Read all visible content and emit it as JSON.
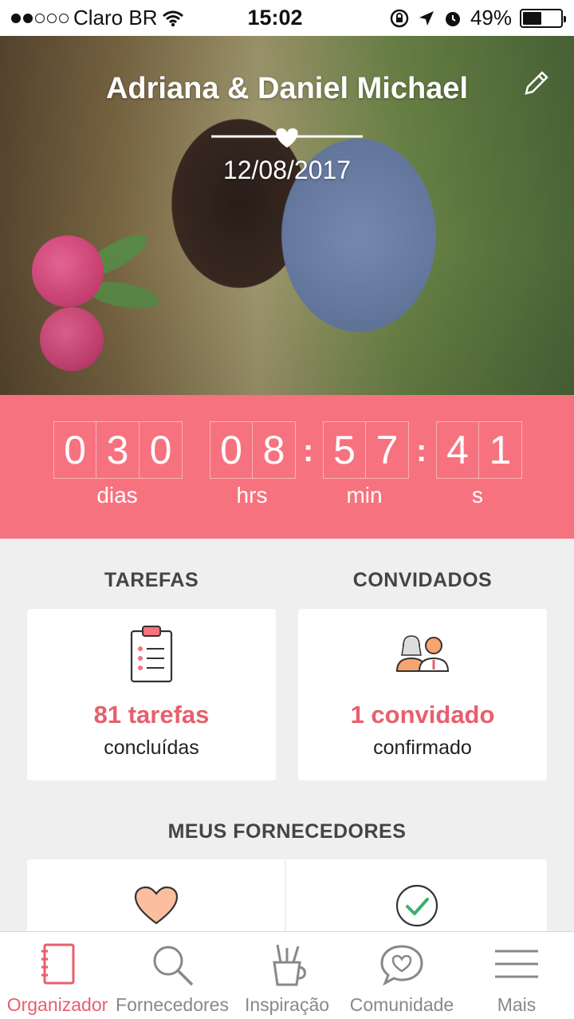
{
  "status_bar": {
    "carrier": "Claro BR",
    "time": "15:02",
    "battery_percent": "49%",
    "battery_level": 0.49,
    "signal_bars": 2
  },
  "hero": {
    "couple_names": "Adriana & Daniel Michael",
    "wedding_date": "12/08/2017",
    "edit_icon": "pencil-icon"
  },
  "countdown": {
    "days_digits": [
      "0",
      "3",
      "0"
    ],
    "hours_digits": [
      "0",
      "8"
    ],
    "minutes_digits": [
      "5",
      "7"
    ],
    "seconds_digits": [
      "4",
      "1"
    ],
    "separator": ":",
    "labels": {
      "days": "dias",
      "hours": "hrs",
      "minutes": "min",
      "seconds": "s"
    }
  },
  "tasks": {
    "title": "TAREFAS",
    "value": "81 tarefas",
    "sub": "concluídas",
    "icon": "clipboard-checklist-icon"
  },
  "guests": {
    "title": "CONVIDADOS",
    "value": "1 convidado",
    "sub": "confirmado",
    "icon": "couple-icon"
  },
  "vendors": {
    "title": "MEUS FORNECEDORES",
    "icons": [
      "heart-icon",
      "check-circle-icon"
    ]
  },
  "tabbar": {
    "items": [
      {
        "label": "Organizador",
        "icon": "notebook-icon",
        "active": true
      },
      {
        "label": "Fornecedores",
        "icon": "magnifier-icon",
        "active": false
      },
      {
        "label": "Inspiração",
        "icon": "pencil-cup-icon",
        "active": false
      },
      {
        "label": "Comunidade",
        "icon": "chat-heart-icon",
        "active": false
      },
      {
        "label": "Mais",
        "icon": "menu-icon",
        "active": false
      }
    ]
  },
  "colors": {
    "accent": "#f7727f",
    "accent_text": "#e85f6d",
    "background": "#efefef"
  }
}
